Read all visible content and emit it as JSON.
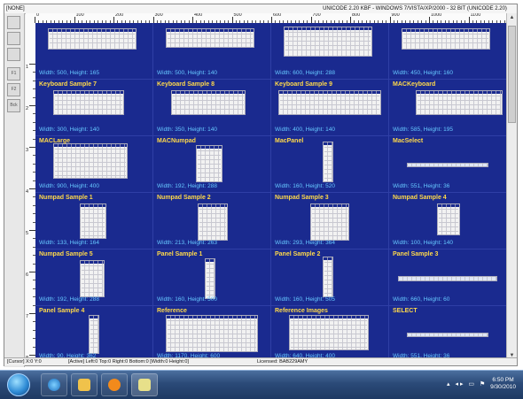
{
  "window": {
    "title_left": "[NONE]",
    "title_right": "UNICODE 2.20 KBF - WINDOWS 7/VISTA/XP/2000 - 32 BIT (UNICODE 2.20)"
  },
  "ruler": {
    "h_labels": [
      "0",
      "100",
      "200",
      "300",
      "400",
      "500",
      "600",
      "700",
      "800",
      "900",
      "1000",
      "1100"
    ],
    "v_labels": [
      "1",
      "2",
      "3",
      "4",
      "5",
      "6",
      "7",
      "8"
    ]
  },
  "tools": {
    "labels": [
      "",
      "",
      "",
      "F1",
      "F2",
      "Bck"
    ]
  },
  "cells": [
    {
      "title": "",
      "dims": "Width: 500, Height: 165"
    },
    {
      "title": "",
      "dims": "Width: 500, Height: 140"
    },
    {
      "title": "",
      "dims": "Width: 600, Height: 288"
    },
    {
      "title": "",
      "dims": "Width: 450, Height: 160"
    },
    {
      "title": "Keyboard Sample 7",
      "dims": "Width: 300, Height: 140"
    },
    {
      "title": "Keyboard Sample 8",
      "dims": "Width: 350, Height: 140"
    },
    {
      "title": "Keyboard Sample 9",
      "dims": "Width: 400, Height: 140"
    },
    {
      "title": "MACKeyboard",
      "dims": "Width: 585, Height: 195"
    },
    {
      "title": "MACLarge",
      "dims": "Width: 900, Height: 400"
    },
    {
      "title": "MACNumpad",
      "dims": "Width: 192, Height: 288"
    },
    {
      "title": "MacPanel",
      "dims": "Width: 160, Height: 520"
    },
    {
      "title": "MacSelect",
      "dims": "Width: 551, Height: 36"
    },
    {
      "title": "Numpad Sample 1",
      "dims": "Width: 133, Height: 164"
    },
    {
      "title": "Numpad Sample 2",
      "dims": "Width: 213, Height: 263"
    },
    {
      "title": "Numpad Sample 3",
      "dims": "Width: 293, Height: 364"
    },
    {
      "title": "Numpad Sample 4",
      "dims": "Width: 100, Height: 140"
    },
    {
      "title": "Numpad Sample 5",
      "dims": "Width: 192, Height: 288"
    },
    {
      "title": "Panel Sample 1",
      "dims": "Width: 160, Height: 500"
    },
    {
      "title": "Panel Sample 2",
      "dims": "Width: 160, Height: 505"
    },
    {
      "title": "Panel Sample 3",
      "dims": "Width: 660, Height: 60"
    },
    {
      "title": "Panel Sample 4",
      "dims": "Width: 90, Height: 362"
    },
    {
      "title": "Reference",
      "dims": "Width: 1170, Height: 600"
    },
    {
      "title": "Reference Images",
      "dims": "Width: 640, Height: 400"
    },
    {
      "title": "SELECT",
      "dims": "Width: 551, Height: 36"
    }
  ],
  "status": {
    "cursor": "[Cursor] X:0 Y:0",
    "active": "[Active] Left:0 Top:0 Right:0 Bottom:0 [Width:0 Height:0]",
    "license": "Licensed: BAB229AMY"
  },
  "taskbar": {
    "time": "6:50 PM",
    "date": "9/30/2010"
  },
  "colors": {
    "canvas": "#1a2a8f",
    "title_text": "#ffd94a",
    "dims_text": "#66c8ff"
  }
}
